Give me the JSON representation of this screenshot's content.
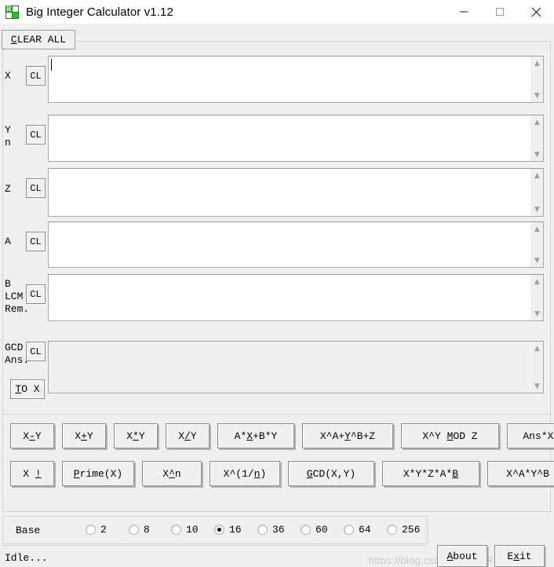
{
  "window": {
    "title": "Big Integer Calculator v1.12",
    "icon": "app-green-squares-icon",
    "minimize_glyph": "—",
    "maximize_glyph": "□",
    "close_glyph": "✕"
  },
  "toolbar": {
    "clear_all_label": "CLEAR ALL",
    "clear_all_accel": "C"
  },
  "fields": [
    {
      "name": "x",
      "label_lines": [
        "X"
      ],
      "clear_label": "CL",
      "value": "",
      "readonly": false,
      "focused": true
    },
    {
      "name": "y",
      "label_lines": [
        "Y",
        "n"
      ],
      "clear_label": "CL",
      "value": "",
      "readonly": false,
      "focused": false
    },
    {
      "name": "z",
      "label_lines": [
        "Z"
      ],
      "clear_label": "CL",
      "value": "",
      "readonly": false,
      "focused": false
    },
    {
      "name": "a",
      "label_lines": [
        "A"
      ],
      "clear_label": "CL",
      "value": "",
      "readonly": false,
      "focused": false
    },
    {
      "name": "b",
      "label_lines": [
        "B",
        "LCM",
        "Rem."
      ],
      "clear_label": "CL",
      "value": "",
      "readonly": false,
      "focused": false
    },
    {
      "name": "gcd",
      "label_lines": [
        "GCD",
        "Ans."
      ],
      "clear_label": "CL",
      "value": "",
      "readonly": true,
      "focused": false,
      "to_x_label": "TO X",
      "to_x_accel": "T"
    }
  ],
  "operations": {
    "row1": [
      {
        "label": "X-Y",
        "accel": "-"
      },
      {
        "label": "X+Y",
        "accel": "+"
      },
      {
        "label": "X*Y",
        "accel": "*"
      },
      {
        "label": "X/Y",
        "accel": "/"
      },
      {
        "label": "A*X+B*Y",
        "accel": "X"
      },
      {
        "label": "X^A+Y^B+Z",
        "accel": "Y"
      },
      {
        "label": "X^Y MOD Z",
        "accel": "M"
      },
      {
        "label": "Ans*X =Y MOD Z",
        "accel": "D"
      }
    ],
    "row2": [
      {
        "label": "X !",
        "accel": "!"
      },
      {
        "label": "Prime(X)",
        "accel": "P"
      },
      {
        "label": "X^n",
        "accel": "^"
      },
      {
        "label": "X^(1/n)",
        "accel": "n"
      },
      {
        "label": "GCD(X,Y)",
        "accel": "G"
      },
      {
        "label": "X*Y*Z*A*B",
        "accel": "B"
      },
      {
        "label": "X^A*Y^B MOD Z",
        "accel": "O"
      }
    ]
  },
  "base": {
    "label": "Base",
    "options": [
      "2",
      "8",
      "10",
      "16",
      "36",
      "60",
      "64",
      "256"
    ],
    "selected": "16"
  },
  "status": {
    "text": "Idle..."
  },
  "bottom_buttons": {
    "about": {
      "label": "About",
      "accel": "A"
    },
    "exit": {
      "label": "Exit",
      "accel": "x"
    }
  },
  "watermark": {
    "text": "https://blog.csdn.net/STARSG0d"
  }
}
